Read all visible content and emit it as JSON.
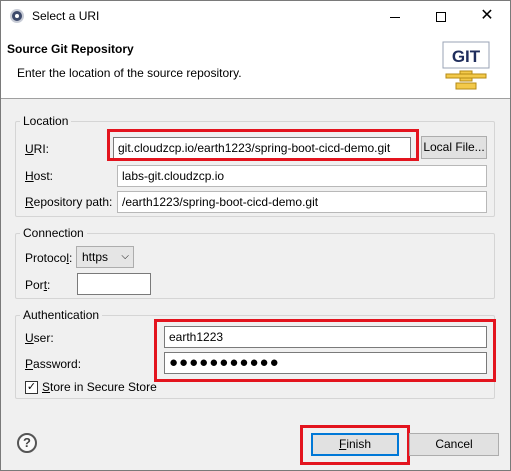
{
  "window": {
    "title": "Select a URI"
  },
  "header": {
    "title": "Source Git Repository",
    "description": "Enter the location of the source repository.",
    "logo_text": "GIT"
  },
  "location": {
    "legend": "Location",
    "uri_label_u": "U",
    "uri_label_rest": "RI:",
    "uri_value": "git.cloudzcp.io/earth1223/spring-boot-cicd-demo.git",
    "local_file_label": "Local File...",
    "host_label_u": "H",
    "host_label_rest": "ost:",
    "host_value": "labs-git.cloudzcp.io",
    "repo_label_u": "R",
    "repo_label_rest": "epository path:",
    "repo_value": "/earth1223/spring-boot-cicd-demo.git"
  },
  "connection": {
    "legend": "Connection",
    "protocol_label_pre": "Protoco",
    "protocol_label_u": "l",
    "protocol_label_post": ":",
    "protocol_value": "https",
    "port_label_pre": "Por",
    "port_label_u": "t",
    "port_label_post": ":",
    "port_value": ""
  },
  "authentication": {
    "legend": "Authentication",
    "user_label_u": "U",
    "user_label_rest": "ser:",
    "user_value": "earth1223",
    "password_label_u": "P",
    "password_label_rest": "assword:",
    "password_value": "●●●●●●●●●●●",
    "store_label_u": "S",
    "store_label_rest": "tore in Secure Store",
    "store_checked": true
  },
  "footer": {
    "help_symbol": "?",
    "finish_u": "F",
    "finish_rest": "inish",
    "cancel_label": "Cancel"
  },
  "colors": {
    "highlight": "#e3141e",
    "accent": "#0078d7"
  }
}
